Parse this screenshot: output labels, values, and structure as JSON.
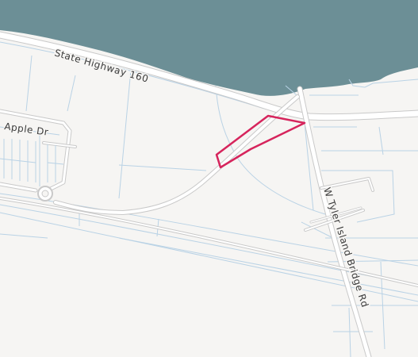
{
  "map": {
    "colors": {
      "background": "#f6f5f3",
      "water": "#6c8f96",
      "parcel_line": "#b9d2e5",
      "road_fill": "#ffffff",
      "road_casing": "#c9c9c9",
      "highlight": "#d6245c"
    },
    "labels": {
      "highway": "State Highway 160",
      "apple": "Apple Dr",
      "bridge_rd": "W Tyler Island Bridge Rd"
    },
    "highlighted_parcel": {
      "icon": "parcel-outline",
      "outline_color": "#d6245c"
    }
  }
}
